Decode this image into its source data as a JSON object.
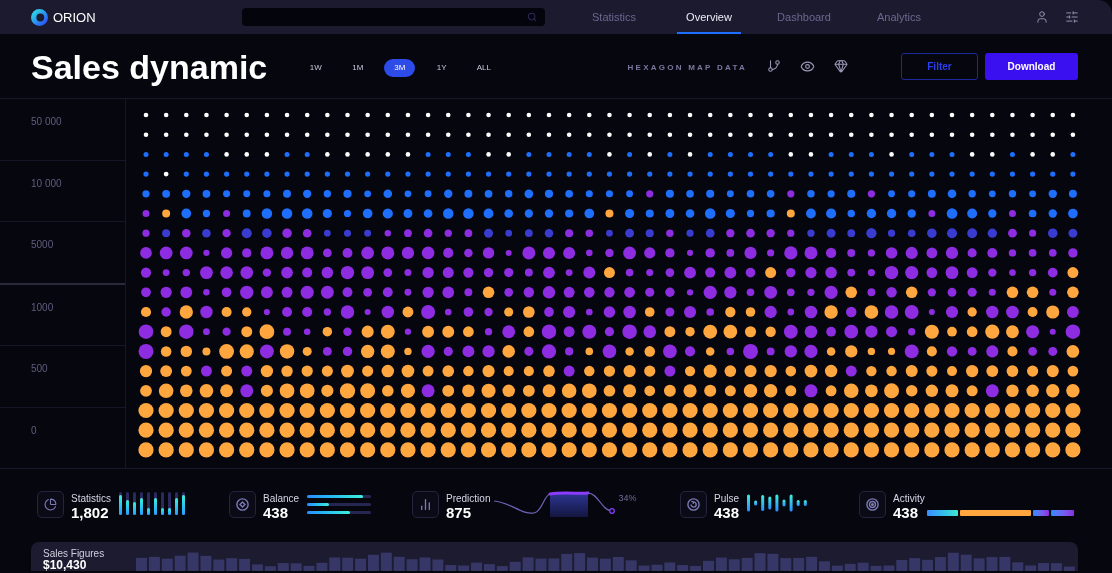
{
  "header": {
    "logo": "ORION"
  },
  "nav_tabs": [
    {
      "label": "Statistics",
      "selected": false
    },
    {
      "label": "Overview",
      "selected": true
    },
    {
      "label": "Dashboard",
      "selected": false
    },
    {
      "label": "Analytics",
      "selected": false
    }
  ],
  "title": "Sales dynamic",
  "ranges": [
    {
      "label": "1W",
      "selected": false
    },
    {
      "label": "1M",
      "selected": false
    },
    {
      "label": "3M",
      "selected": true
    },
    {
      "label": "1Y",
      "selected": false
    },
    {
      "label": "ALL",
      "selected": false
    }
  ],
  "view_label": "HEXAGON MAP DATA",
  "buttons": [
    {
      "label": "Filter",
      "kind": "outline"
    },
    {
      "label": "Download",
      "kind": "primary"
    }
  ],
  "y_axis_labels": [
    "50 000",
    "10 000",
    "5000",
    "1000",
    "500",
    "0"
  ],
  "stats": [
    {
      "kind": "bars",
      "label": "Statistics",
      "value": "1,802",
      "bars": [
        {
          "level": 0.85
        },
        {
          "level": 0.66
        },
        {
          "level": 0.57
        },
        {
          "level": 0.74
        },
        {
          "level": 0.31
        },
        {
          "level": 0.74
        },
        {
          "level": 0.31
        },
        {
          "level": 0.31
        },
        {
          "level": 0.74
        },
        {
          "level": 0.85
        }
      ]
    },
    {
      "kind": "progress",
      "label": "Balance",
      "value": "438",
      "bars": [
        {
          "level": 0.88
        },
        {
          "level": 0.34
        },
        {
          "level": 0.67
        }
      ]
    },
    {
      "kind": "sparkline",
      "label": "Prediction",
      "value": "875",
      "percent": "34%"
    },
    {
      "kind": "waveform",
      "label": "Pulse",
      "value": "438"
    },
    {
      "kind": "segments",
      "label": "Activity",
      "value": "438"
    }
  ],
  "sales_figures": {
    "title": "Sales Figures",
    "value": "$10,430"
  }
}
